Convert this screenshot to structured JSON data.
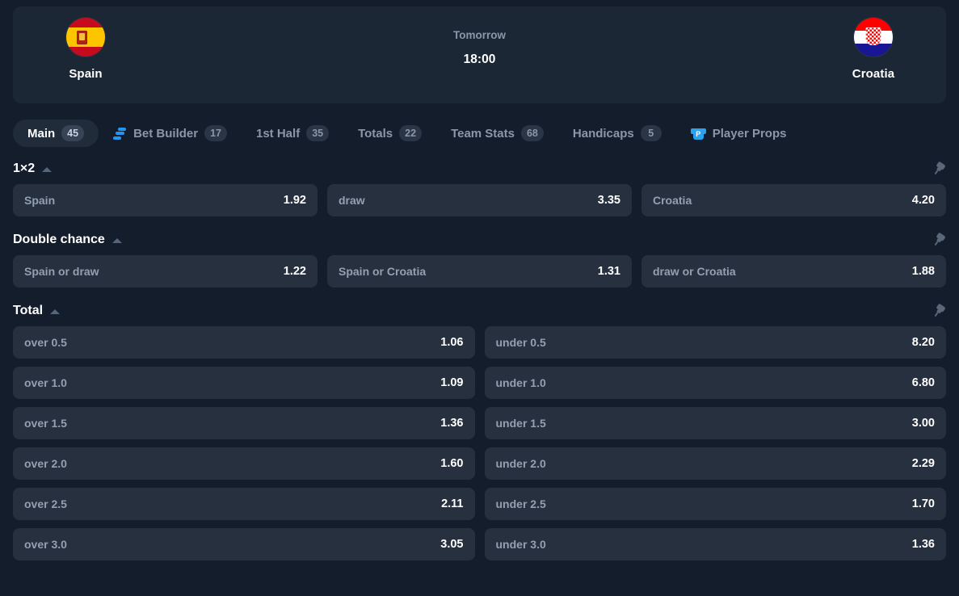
{
  "match": {
    "home_team": "Spain",
    "away_team": "Croatia",
    "home_flag_icon": "spain-flag-icon",
    "away_flag_icon": "croatia-flag-icon",
    "day_label": "Tomorrow",
    "kickoff_time": "18:00"
  },
  "tabs": [
    {
      "label": "Main",
      "badge": "45",
      "active": true,
      "icon": null
    },
    {
      "label": "Bet Builder",
      "badge": "17",
      "active": false,
      "icon": "bet-builder-icon"
    },
    {
      "label": "1st Half",
      "badge": "35",
      "active": false,
      "icon": null
    },
    {
      "label": "Totals",
      "badge": "22",
      "active": false,
      "icon": null
    },
    {
      "label": "Team Stats",
      "badge": "68",
      "active": false,
      "icon": null
    },
    {
      "label": "Handicaps",
      "badge": "5",
      "active": false,
      "icon": null
    },
    {
      "label": "Player Props",
      "badge": "",
      "active": false,
      "icon": "jersey-icon"
    }
  ],
  "markets": [
    {
      "title": "1×2",
      "collapse_icon": "caret-up-icon",
      "pin_icon": "pin-icon",
      "columns": 3,
      "rows": [
        [
          {
            "label": "Spain",
            "odds": "1.92"
          },
          {
            "label": "draw",
            "odds": "3.35"
          },
          {
            "label": "Croatia",
            "odds": "4.20"
          }
        ]
      ]
    },
    {
      "title": "Double chance",
      "collapse_icon": "caret-up-icon",
      "pin_icon": "pin-icon",
      "columns": 3,
      "rows": [
        [
          {
            "label": "Spain or draw",
            "odds": "1.22"
          },
          {
            "label": "Spain or Croatia",
            "odds": "1.31"
          },
          {
            "label": "draw or Croatia",
            "odds": "1.88"
          }
        ]
      ]
    },
    {
      "title": "Total",
      "collapse_icon": "caret-up-icon",
      "pin_icon": "pin-icon",
      "columns": 2,
      "rows": [
        [
          {
            "label": "over 0.5",
            "odds": "1.06"
          },
          {
            "label": "under 0.5",
            "odds": "8.20"
          }
        ],
        [
          {
            "label": "over 1.0",
            "odds": "1.09"
          },
          {
            "label": "under 1.0",
            "odds": "6.80"
          }
        ],
        [
          {
            "label": "over 1.5",
            "odds": "1.36"
          },
          {
            "label": "under 1.5",
            "odds": "3.00"
          }
        ],
        [
          {
            "label": "over 2.0",
            "odds": "1.60"
          },
          {
            "label": "under 2.0",
            "odds": "2.29"
          }
        ],
        [
          {
            "label": "over 2.5",
            "odds": "2.11"
          },
          {
            "label": "under 2.5",
            "odds": "1.70"
          }
        ],
        [
          {
            "label": "over 3.0",
            "odds": "3.05"
          },
          {
            "label": "under 3.0",
            "odds": "1.36"
          }
        ]
      ]
    }
  ],
  "colors": {
    "page_bg": "#141d2b",
    "card_bg": "#1c2735",
    "odds_bg": "#27303e",
    "accent_blue": "#2196f3",
    "label_text": "#93a0b1",
    "value_text": "#ffffff"
  }
}
